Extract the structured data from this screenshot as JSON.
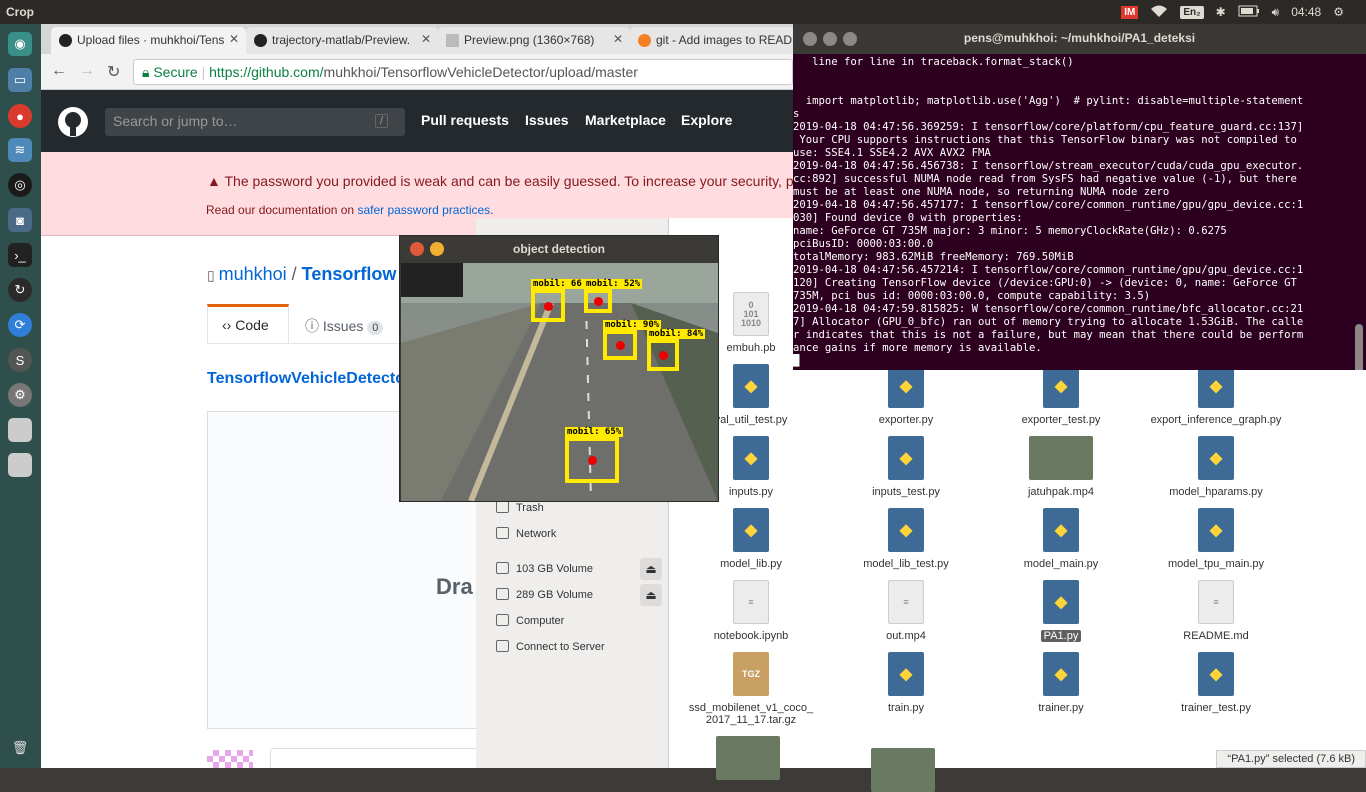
{
  "topbar": {
    "app_title": "Crop",
    "keyboard": "En₂",
    "clock": "04:48",
    "indicator": "IM"
  },
  "browser": {
    "tabs": [
      {
        "label": "Upload files · muhkhoi/Tens"
      },
      {
        "label": "trajectory-matlab/Preview."
      },
      {
        "label": "Preview.png (1360×768)"
      },
      {
        "label": "git - Add images to READM"
      }
    ],
    "secure_label": "Secure",
    "url_host": "https://github.com/",
    "url_path": "muhkhoi/TensorflowVehicleDetector/upload/master"
  },
  "github": {
    "search_placeholder": "Search or jump to…",
    "search_key": "/",
    "nav": [
      "Pull requests",
      "Issues",
      "Marketplace",
      "Explore"
    ],
    "flash_message": "The password you provided is weak and can be easily guessed. To increase your security, p",
    "flash_doc_prefix": "Read our documentation on ",
    "flash_doc_link": "safer password practices",
    "flash_doc_suffix": ".",
    "owner": "muhkhoi",
    "repo_sep": " / ",
    "repo": "Tensorflow",
    "tab_code": "Code",
    "tab_issues": "Issues",
    "issues_count": "0",
    "breadcrumb": "TensorflowVehicleDetecto",
    "drag_text": "Dra"
  },
  "terminal": {
    "title": "pens@muhkhoi: ~/muhkhoi/PA1_deteksi",
    "text": "   line for line in traceback.format_stack()\n\n\n  import matplotlib; matplotlib.use('Agg')  # pylint: disable=multiple-statement\ns\n2019-04-18 04:47:56.369259: I tensorflow/core/platform/cpu_feature_guard.cc:137]\n Your CPU supports instructions that this TensorFlow binary was not compiled to\nuse: SSE4.1 SSE4.2 AVX AVX2 FMA\n2019-04-18 04:47:56.456738: I tensorflow/stream_executor/cuda/cuda_gpu_executor.\ncc:892] successful NUMA node read from SysFS had negative value (-1), but there\nmust be at least one NUMA node, so returning NUMA node zero\n2019-04-18 04:47:56.457177: I tensorflow/core/common_runtime/gpu/gpu_device.cc:1\n030] Found device 0 with properties:\nname: GeForce GT 735M major: 3 minor: 5 memoryClockRate(GHz): 0.6275\npciBusID: 0000:03:00.0\ntotalMemory: 983.62MiB freeMemory: 769.50MiB\n2019-04-18 04:47:56.457214: I tensorflow/core/common_runtime/gpu/gpu_device.cc:1\n120] Creating TensorFlow device (/device:GPU:0) -> (device: 0, name: GeForce GT\n735M, pci bus id: 0000:03:00.0, compute capability: 3.5)\n2019-04-18 04:47:59.815825: W tensorflow/core/common_runtime/bfc_allocator.cc:21\n7] Allocator (GPU_0_bfc) ran out of memory trying to allocate 1.53GiB. The calle\nr indicates that this is not a failure, but may mean that there could be perform\nance gains if more memory is available.\n█"
  },
  "detection": {
    "title": "object detection",
    "boxes": [
      {
        "label": "mobil: 66"
      },
      {
        "label": "mobil: 52%"
      },
      {
        "label": "mobil: 90%"
      },
      {
        "label": "mobil: 84%"
      },
      {
        "label": "mobil: 65%"
      }
    ]
  },
  "filemanager": {
    "sidebar": [
      "Trash",
      "Network",
      "103 GB Volume",
      "289 GB Volume",
      "Computer",
      "Connect to Server"
    ],
    "files": [
      {
        "name": "embuh.pb",
        "icon": "binary-file-icon"
      },
      {
        "name": "val_util_test.py",
        "icon": "python-file-icon"
      },
      {
        "name": "exporter.py",
        "icon": "python-file-icon"
      },
      {
        "name": "exporter_test.py",
        "icon": "python-file-icon"
      },
      {
        "name": "export_inference_graph.py",
        "icon": "python-file-icon"
      },
      {
        "name": "inputs.py",
        "icon": "python-file-icon"
      },
      {
        "name": "inputs_test.py",
        "icon": "python-file-icon"
      },
      {
        "name": "jatuhpak.mp4",
        "icon": "video-thumbnail-icon"
      },
      {
        "name": "model_hparams.py",
        "icon": "python-file-icon"
      },
      {
        "name": "model_lib.py",
        "icon": "python-file-icon"
      },
      {
        "name": "model_lib_test.py",
        "icon": "python-file-icon"
      },
      {
        "name": "model_main.py",
        "icon": "python-file-icon"
      },
      {
        "name": "model_tpu_main.py",
        "icon": "python-file-icon"
      },
      {
        "name": "notebook.ipynb",
        "icon": "text-file-icon"
      },
      {
        "name": "out.mp4",
        "icon": "text-file-icon"
      },
      {
        "name": "PA1.py",
        "icon": "python-file-icon"
      },
      {
        "name": "README.md",
        "icon": "text-file-icon"
      },
      {
        "name": "ssd_mobilenet_v1_coco_\n2017_11_17.tar.gz",
        "icon": "tgz-archive-icon"
      },
      {
        "name": "train.py",
        "icon": "python-file-icon"
      },
      {
        "name": "trainer.py",
        "icon": "python-file-icon"
      },
      {
        "name": "trainer_test.py",
        "icon": "python-file-icon"
      }
    ],
    "binary_glyph": "0\n101\n1010",
    "tgz_glyph": "TGZ",
    "status": "“PA1.py” selected  (7.6 kB)"
  }
}
